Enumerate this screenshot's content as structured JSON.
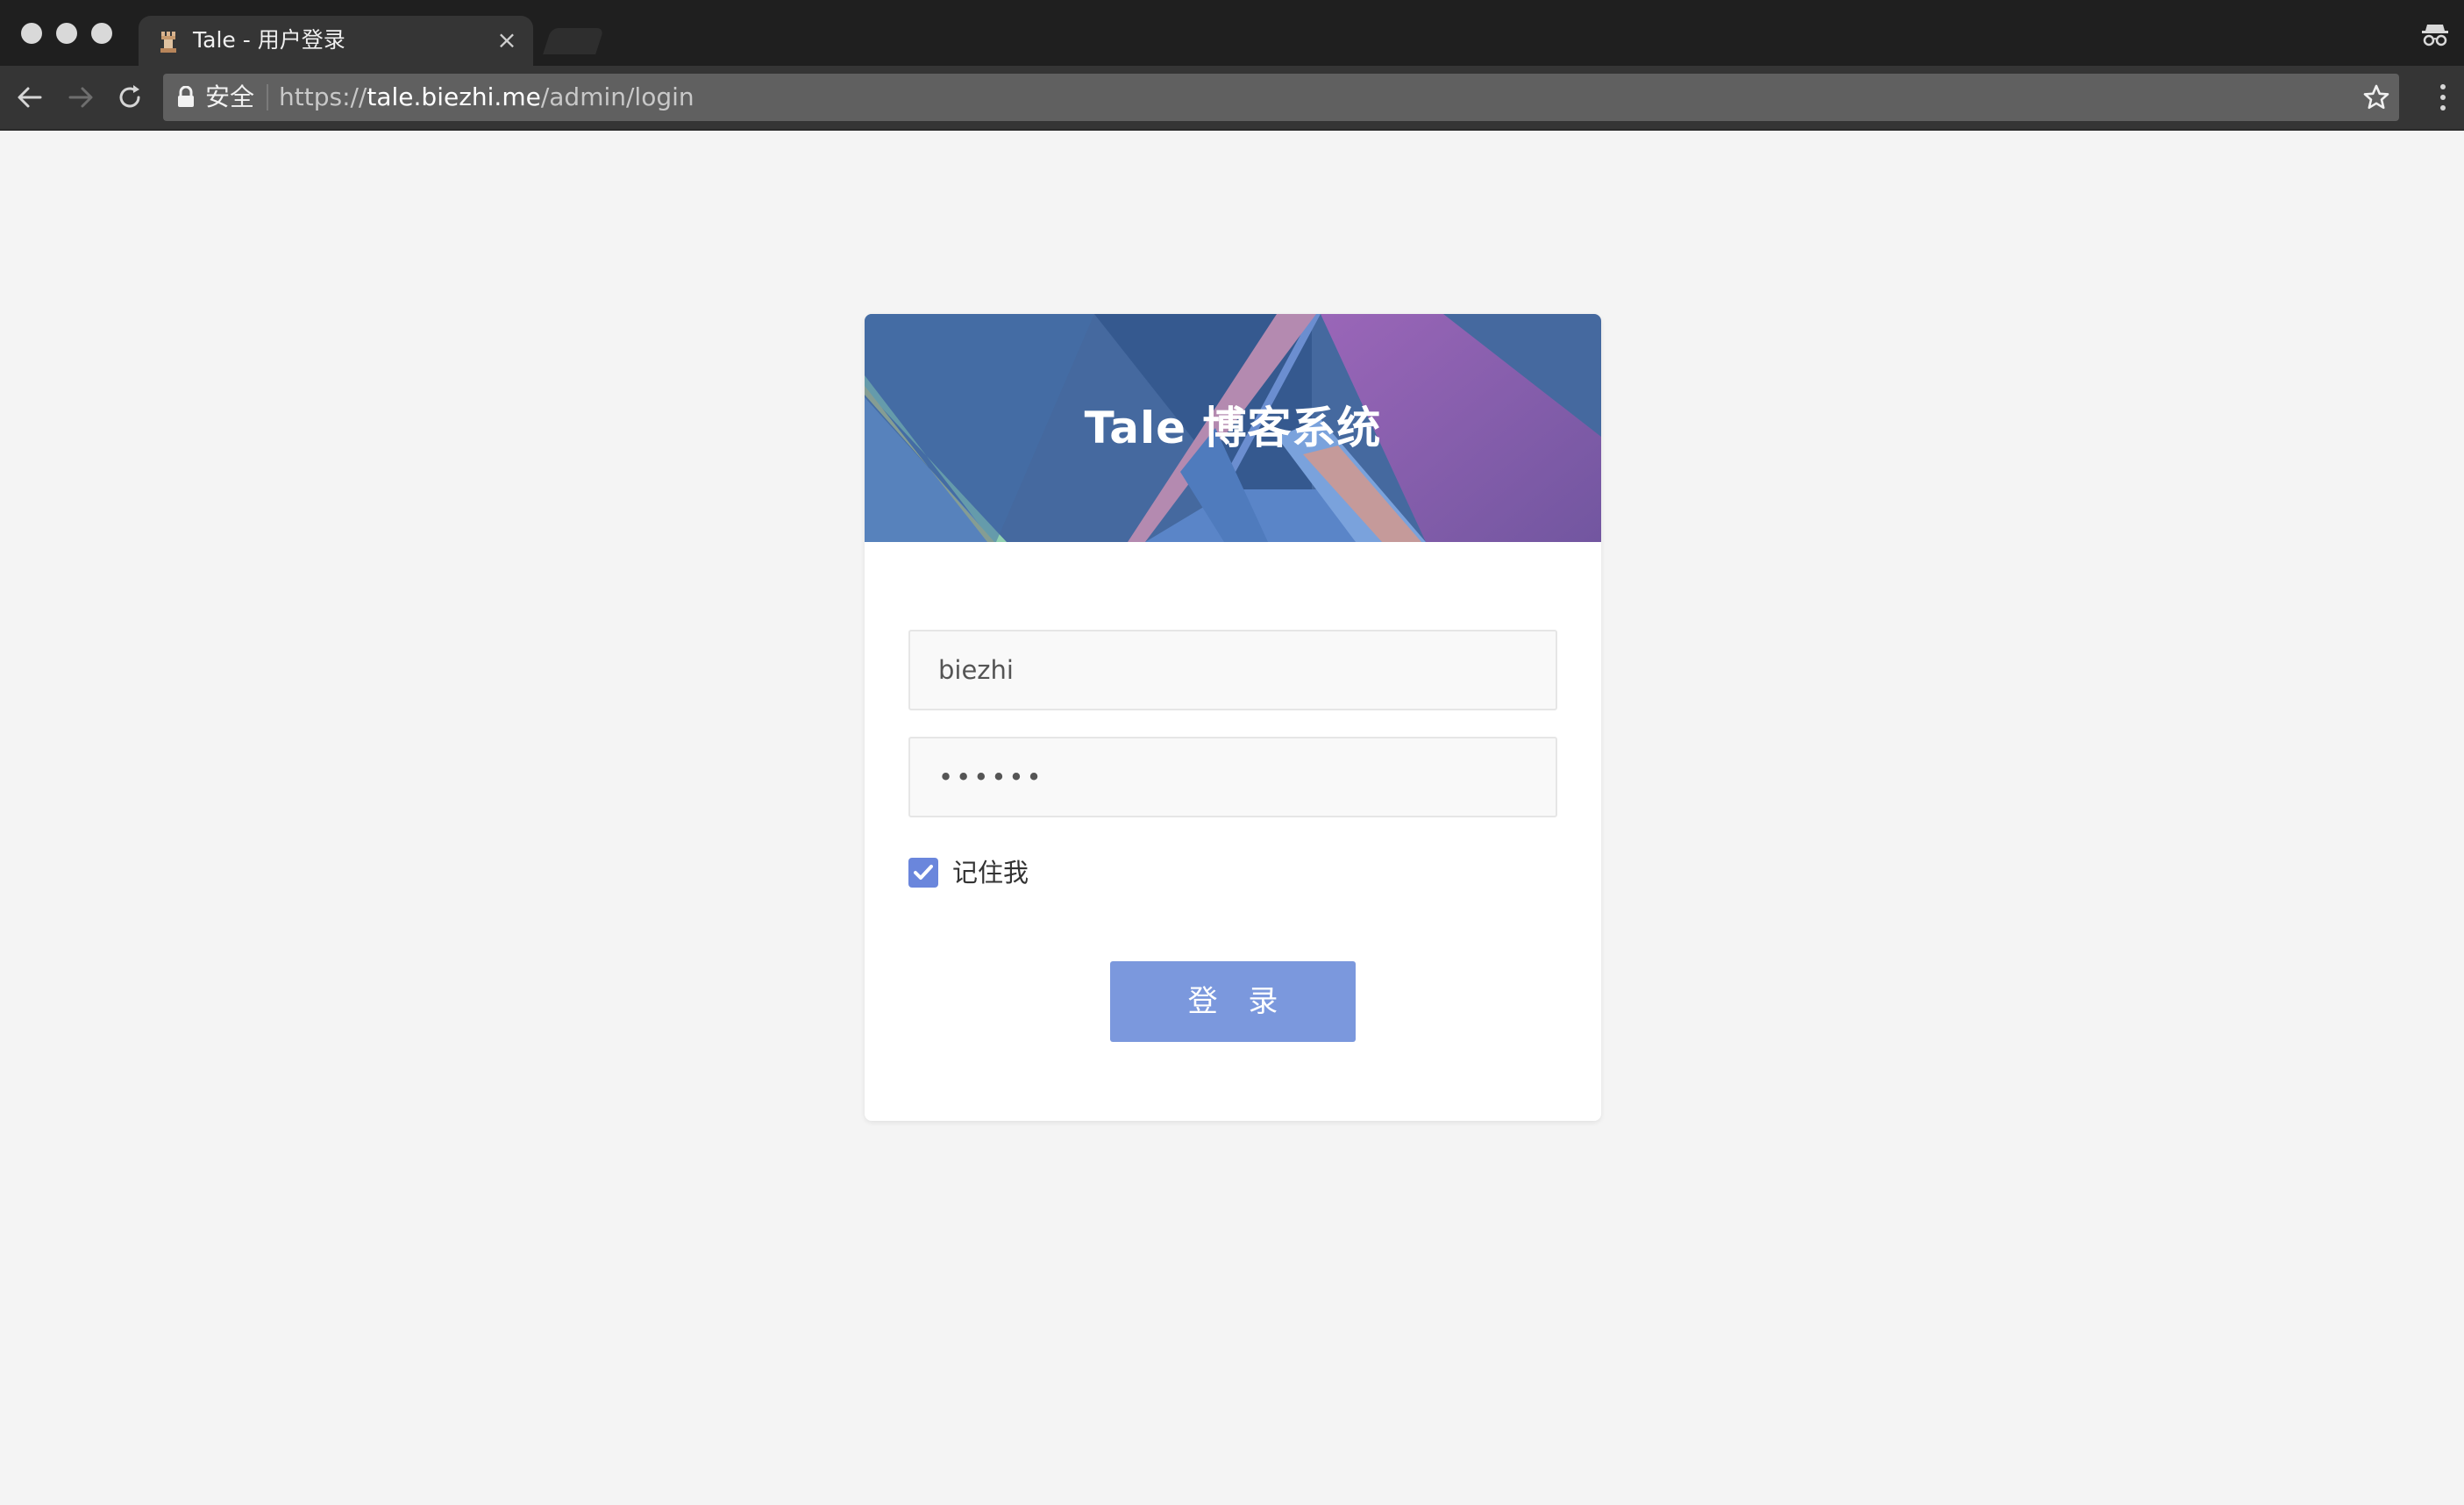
{
  "browser": {
    "tab": {
      "title": "Tale - 用户登录",
      "close_glyph": "×",
      "favicon": "chess-rook-icon"
    },
    "toolbar": {
      "back_icon": "back-arrow-icon",
      "forward_icon": "forward-arrow-icon",
      "reload_icon": "reload-icon",
      "security_label": "安全",
      "url_scheme": "https://",
      "url_host": "tale.biezhi.me",
      "url_path": "/admin/login",
      "bookmark_icon": "star-icon",
      "menu_icon": "kebab-menu-icon"
    },
    "incognito_icon": "incognito-icon"
  },
  "login": {
    "title": "Tale 博客系统",
    "username_value": "biezhi",
    "password_value": "••••••",
    "remember_checked": true,
    "remember_label": "记住我",
    "submit_label": "登 录"
  },
  "colors": {
    "page_background": "#f4f4f4",
    "browser_frame": "#1f1f1f",
    "button": "#7b98dd",
    "checkbox": "#6a86dc"
  }
}
